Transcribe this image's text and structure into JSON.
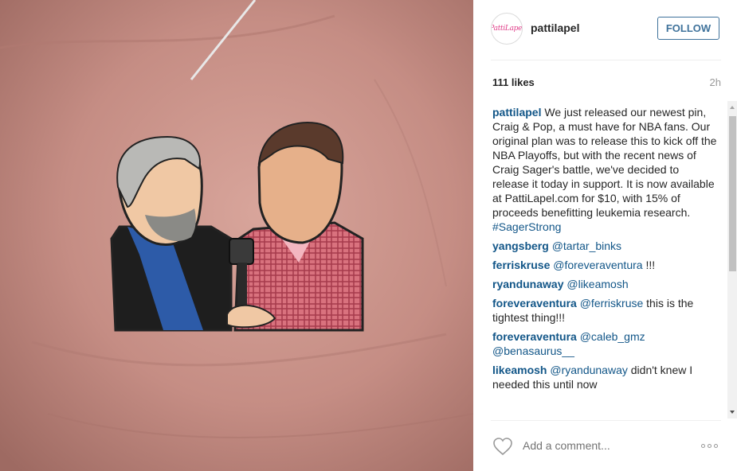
{
  "post": {
    "username": "pattilapel",
    "avatar_text": "PattiLapel",
    "follow_label": "FOLLOW",
    "likes": "111 likes",
    "time": "2h"
  },
  "comments": [
    {
      "user": "pattilapel",
      "text": " We just released our newest pin, Craig & Pop, a must have for NBA fans. Our original plan was to release this to kick off the NBA Playoffs, but with the recent news of Craig Sager's battle, we've decided to release it today in support. It is now available at PattiLapel.com for $10, with 15% of proceeds benefitting leukemia research. ",
      "tag": "#SagerStrong",
      "after": ""
    },
    {
      "user": "yangsberg",
      "text": " ",
      "tag": "@tartar_binks",
      "after": ""
    },
    {
      "user": "ferriskruse",
      "text": " ",
      "tag": "@foreveraventura",
      "after": " !!!"
    },
    {
      "user": "ryandunaway",
      "text": " ",
      "tag": "@likeamosh",
      "after": ""
    },
    {
      "user": "foreveraventura",
      "text": " ",
      "tag": "@ferriskruse",
      "after": " this is the tightest thing!!!"
    },
    {
      "user": "foreveraventura",
      "text": " ",
      "tag": "@caleb_gmz @benasaurus__",
      "after": ""
    },
    {
      "user": "likeamosh",
      "text": " ",
      "tag": "@ryandunaway",
      "after": " didn't knew I needed this until now"
    }
  ],
  "composer": {
    "placeholder": "Add a comment...",
    "like_icon": "heart-icon",
    "more_icon": "more-options-icon"
  },
  "colors": {
    "link": "#125688",
    "follow_blue": "#3f729b",
    "skin_bg": "#c9928a"
  }
}
